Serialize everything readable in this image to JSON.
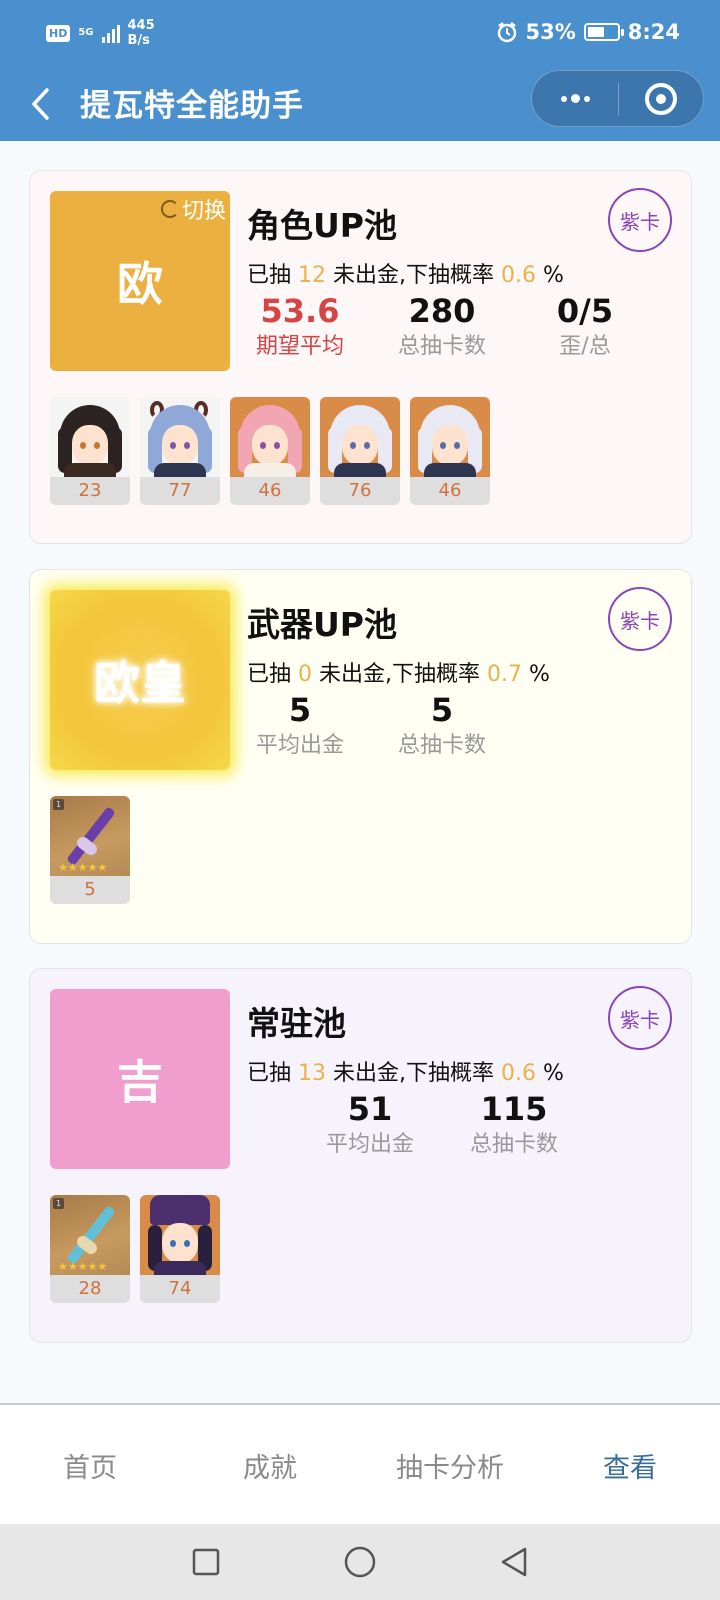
{
  "status_bar": {
    "hd": "HD",
    "net": "5G",
    "speed_value": "445",
    "speed_unit": "B/s",
    "battery": "53%",
    "time": "8:24"
  },
  "header": {
    "title": "提瓦特全能助手"
  },
  "pools": [
    {
      "title": "角色UP池",
      "luck_label": "欧",
      "switch_label": "切换",
      "purple_label": "紫卡",
      "info": {
        "prefix": "已抽",
        "count": "12",
        "middle": "未出金,下抽概率",
        "prob": "0.6",
        "suffix": "%"
      },
      "stats": [
        {
          "value": "53.6",
          "label": "期望平均"
        },
        {
          "value": "280",
          "label": "总抽卡数"
        },
        {
          "value": "0/5",
          "label": "歪/总"
        }
      ],
      "items": [
        "23",
        "77",
        "46",
        "76",
        "46"
      ]
    },
    {
      "title": "武器UP池",
      "luck_label": "欧皇",
      "purple_label": "紫卡",
      "info": {
        "prefix": "已抽",
        "count": "0",
        "middle": "未出金,下抽概率",
        "prob": "0.7",
        "suffix": "%"
      },
      "stats": [
        {
          "value": "5",
          "label": "平均出金"
        },
        {
          "value": "5",
          "label": "总抽卡数"
        }
      ],
      "items": [
        "5"
      ]
    },
    {
      "title": "常驻池",
      "luck_label": "吉",
      "purple_label": "紫卡",
      "info": {
        "prefix": "已抽",
        "count": "13",
        "middle": "未出金,下抽概率",
        "prob": "0.6",
        "suffix": "%"
      },
      "stats": [
        {
          "value": "51",
          "label": "平均出金"
        },
        {
          "value": "115",
          "label": "总抽卡数"
        }
      ],
      "items": [
        "28",
        "74"
      ]
    }
  ],
  "tabs": [
    "首页",
    "成就",
    "抽卡分析",
    "查看"
  ],
  "colors": {
    "header_bg": "#4a8fce",
    "accent_number": "#e8b24c",
    "expect_red": "#d64545",
    "purple": "#8a45b7",
    "active_tab": "#3a6d9a"
  }
}
